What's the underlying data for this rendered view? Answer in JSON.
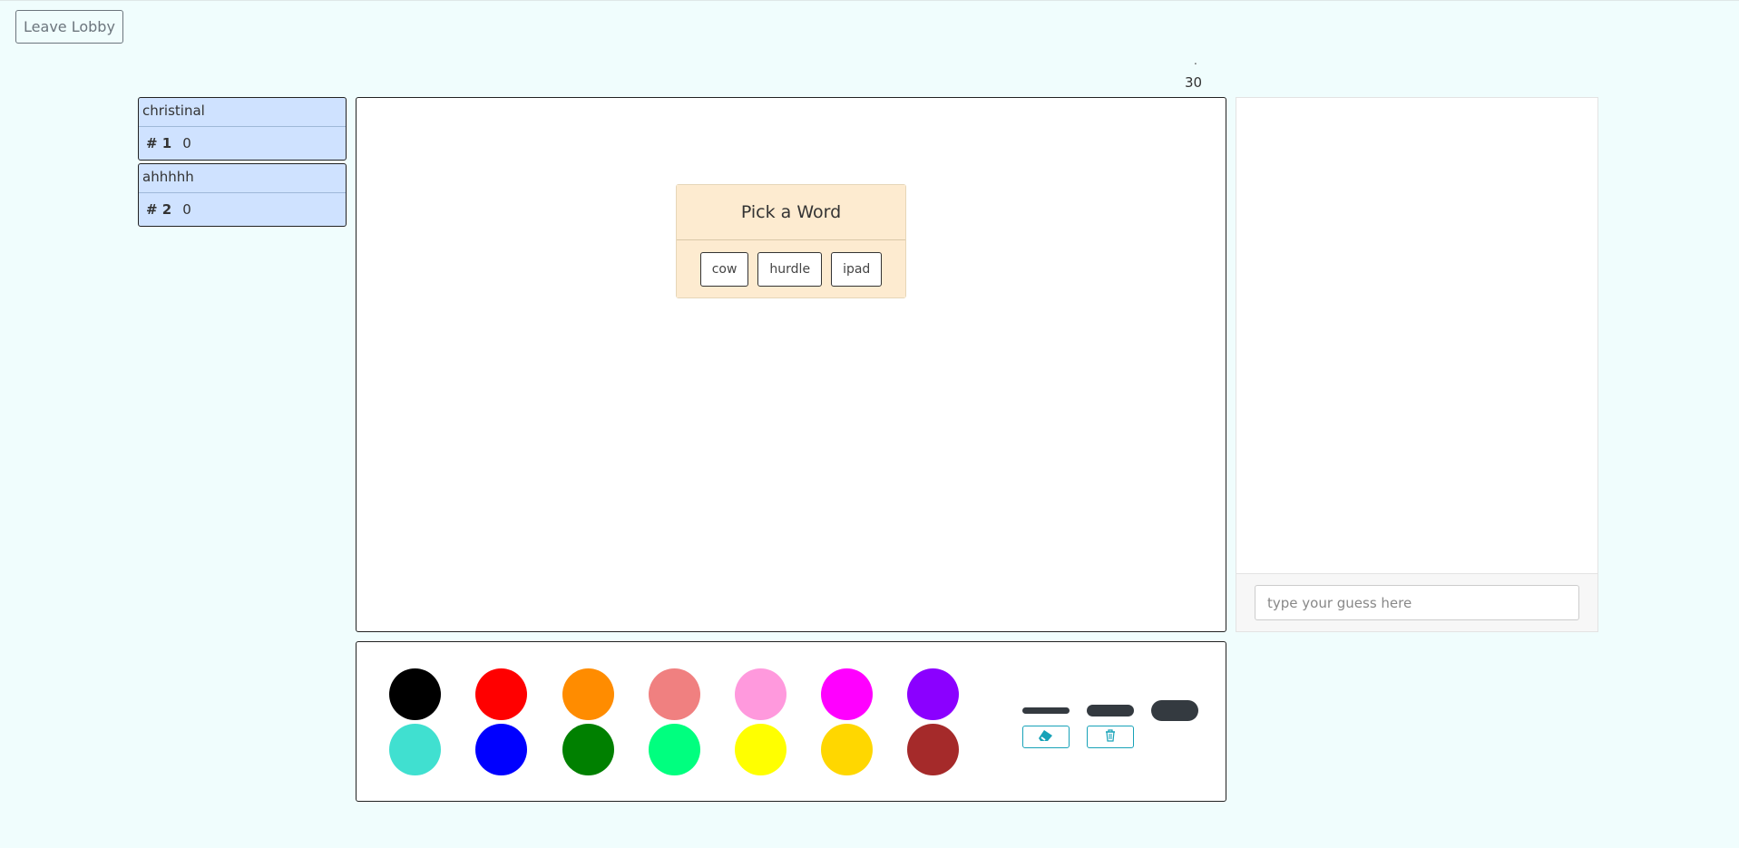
{
  "header": {
    "leave_label": "Leave Lobby"
  },
  "timer": {
    "dot": ".",
    "seconds": "30"
  },
  "players": [
    {
      "name": "christinal",
      "rank": "# 1",
      "score": "0"
    },
    {
      "name": "ahhhhh",
      "rank": "# 2",
      "score": "0"
    }
  ],
  "word_picker": {
    "title": "Pick a Word",
    "words": [
      "cow",
      "hurdle",
      "ipad"
    ]
  },
  "chat": {
    "placeholder": "type your guess here"
  },
  "palette": {
    "colors_row1": [
      "#000000",
      "#ff0000",
      "#ff8c00",
      "#f08080",
      "#ff99dd",
      "#ff00ff",
      "#8b00ff"
    ],
    "colors_row2": [
      "#40e0d0",
      "#0000ff",
      "#008000",
      "#00ff7f",
      "#ffff00",
      "#ffd700",
      "#a52a2a"
    ],
    "brush_sizes": [
      "small",
      "medium",
      "large"
    ],
    "tools": [
      "eraser-icon",
      "trash-icon"
    ]
  }
}
